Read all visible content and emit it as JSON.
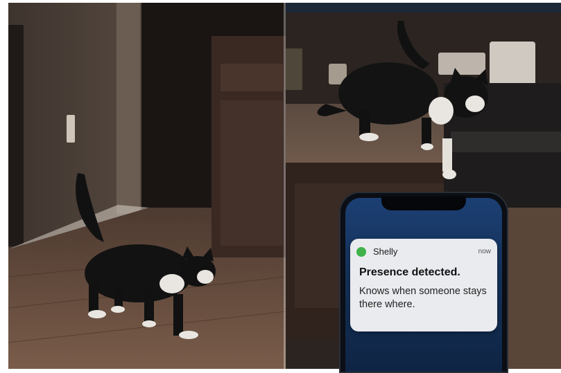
{
  "scene": {
    "colors": {
      "wall": "#4a4038",
      "floor": "#6a4f3f",
      "cabinet": "#3c2c25",
      "cat_black": "#111111",
      "cat_white": "#e9e6e1"
    }
  },
  "notification": {
    "app_name": "Shelly",
    "time": "now",
    "title": "Presence detected.",
    "body": "Knows when someone stays there where.",
    "status_color": "#3fb24b"
  }
}
